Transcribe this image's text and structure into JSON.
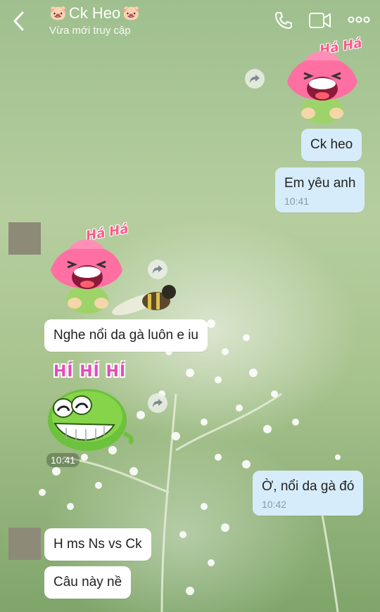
{
  "header": {
    "title": "Ck Heo",
    "title_emoji": "🐷",
    "status": "Vừa mới truy cập",
    "icons": [
      "back-chevron-icon",
      "phone-icon",
      "video-icon",
      "more-icon"
    ]
  },
  "messages": [
    {
      "from": "me",
      "type": "sticker",
      "sticker_text": "Há Há",
      "sticker": "laughing-flower"
    },
    {
      "from": "me",
      "type": "text",
      "text": "Ck heo"
    },
    {
      "from": "me",
      "type": "text",
      "text": "Em yêu anh",
      "time": "10:41"
    },
    {
      "from": "other",
      "type": "sticker",
      "sticker_text": "Há Há",
      "sticker": "laughing-flower"
    },
    {
      "from": "other",
      "type": "text",
      "text": "Nghe nổi da gà luôn e iu"
    },
    {
      "from": "other",
      "type": "sticker",
      "sticker_text": "HÍ HÍ HÍ",
      "sticker": "green-grin-blob",
      "time": "10:41"
    },
    {
      "from": "me",
      "type": "text",
      "text": "Ờ, nổi da gà đó",
      "time": "10:42"
    },
    {
      "from": "other",
      "type": "text",
      "text": "H ms Ns vs Ck"
    },
    {
      "from": "other",
      "type": "text",
      "text": "Câu này nề"
    }
  ],
  "colors": {
    "my_bubble": "#d6ecfa",
    "their_bubble": "#ffffff",
    "header_text": "#ffffff"
  }
}
